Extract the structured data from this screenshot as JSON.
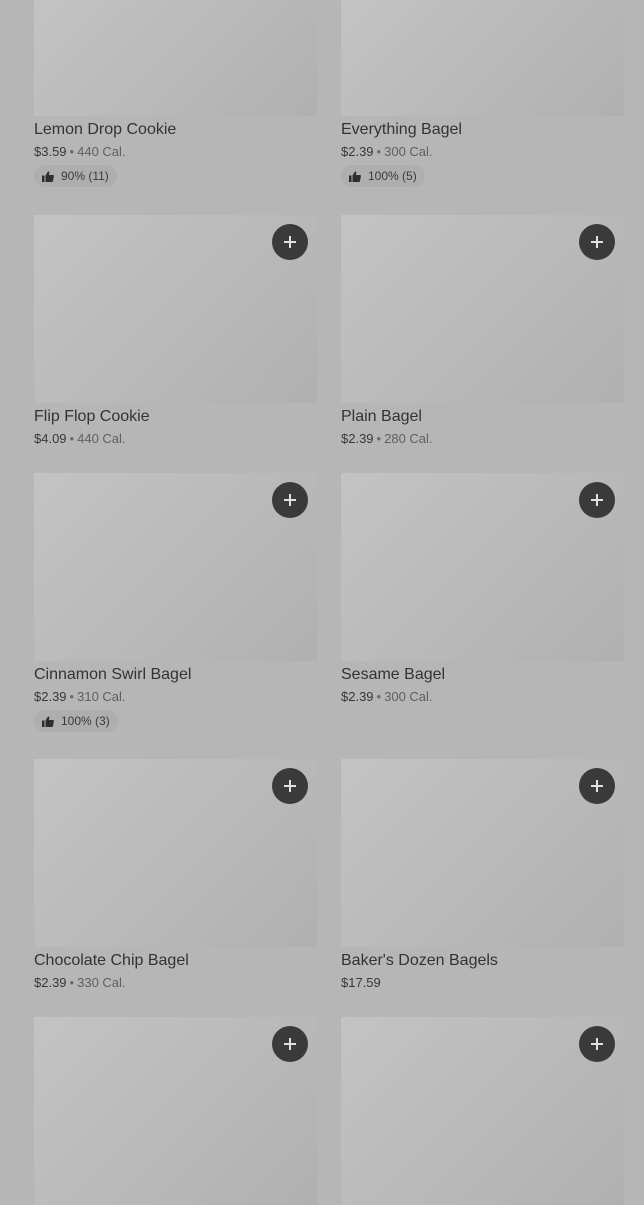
{
  "products": [
    {
      "name": "Lemon Drop Cookie",
      "price": "$3.59",
      "calories": "440 Cal.",
      "rating": "90% (11)"
    },
    {
      "name": "Everything Bagel",
      "price": "$2.39",
      "calories": "300 Cal.",
      "rating": "100% (5)"
    },
    {
      "name": "Flip Flop Cookie",
      "price": "$4.09",
      "calories": "440 Cal.",
      "rating": ""
    },
    {
      "name": "Plain Bagel",
      "price": "$2.39",
      "calories": "280 Cal.",
      "rating": ""
    },
    {
      "name": "Cinnamon Swirl Bagel",
      "price": "$2.39",
      "calories": "310 Cal.",
      "rating": "100% (3)"
    },
    {
      "name": "Sesame Bagel",
      "price": "$2.39",
      "calories": "300 Cal.",
      "rating": ""
    },
    {
      "name": "Chocolate Chip Bagel",
      "price": "$2.39",
      "calories": "330 Cal.",
      "rating": ""
    },
    {
      "name": "Baker's Dozen Bagels",
      "price": "$17.59",
      "calories": "",
      "rating": ""
    }
  ],
  "separator": "•",
  "icons": {
    "add": "plus-icon",
    "rating": "thumbs-up-icon"
  }
}
